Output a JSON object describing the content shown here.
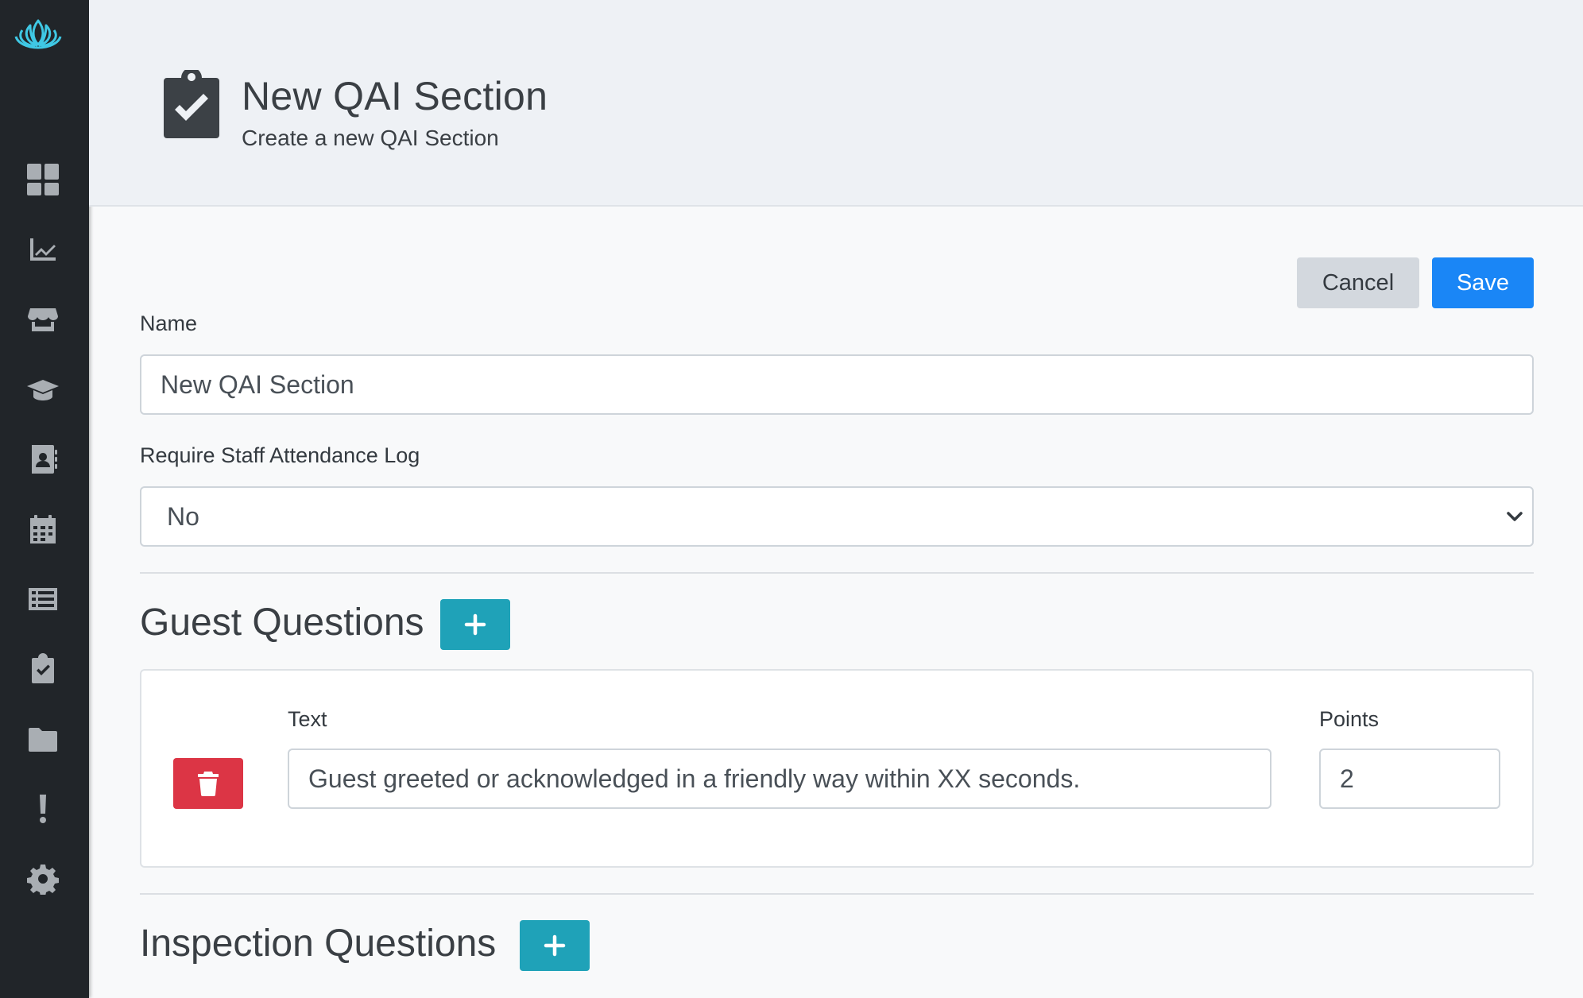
{
  "sidebar": {
    "logo": "lotus-logo",
    "items": [
      {
        "icon": "dashboard-icon"
      },
      {
        "icon": "chart-line-icon"
      },
      {
        "icon": "store-icon"
      },
      {
        "icon": "graduation-cap-icon"
      },
      {
        "icon": "contact-book-icon"
      },
      {
        "icon": "calendar-icon"
      },
      {
        "icon": "list-icon"
      },
      {
        "icon": "clipboard-check-icon"
      },
      {
        "icon": "folder-icon"
      },
      {
        "icon": "exclamation-icon"
      },
      {
        "icon": "gear-icon"
      }
    ]
  },
  "header": {
    "icon": "clipboard-check-icon",
    "title": "New QAI Section",
    "subtitle": "Create a new QAI Section"
  },
  "actions": {
    "cancel_label": "Cancel",
    "save_label": "Save"
  },
  "form": {
    "name_label": "Name",
    "name_value": "New QAI Section",
    "attendance_label": "Require Staff Attendance Log",
    "attendance_value": "No"
  },
  "guest_questions": {
    "title": "Guest Questions",
    "text_label": "Text",
    "points_label": "Points",
    "items": [
      {
        "text": "Guest greeted or acknowledged in a friendly way within XX seconds.",
        "points": "2"
      }
    ]
  },
  "inspection_questions": {
    "title": "Inspection Questions"
  },
  "colors": {
    "sidebar": "#212529",
    "primary": "#1a86f6",
    "info": "#1fa2b8",
    "danger": "#dc3545",
    "logo": "#3fc8e4"
  }
}
